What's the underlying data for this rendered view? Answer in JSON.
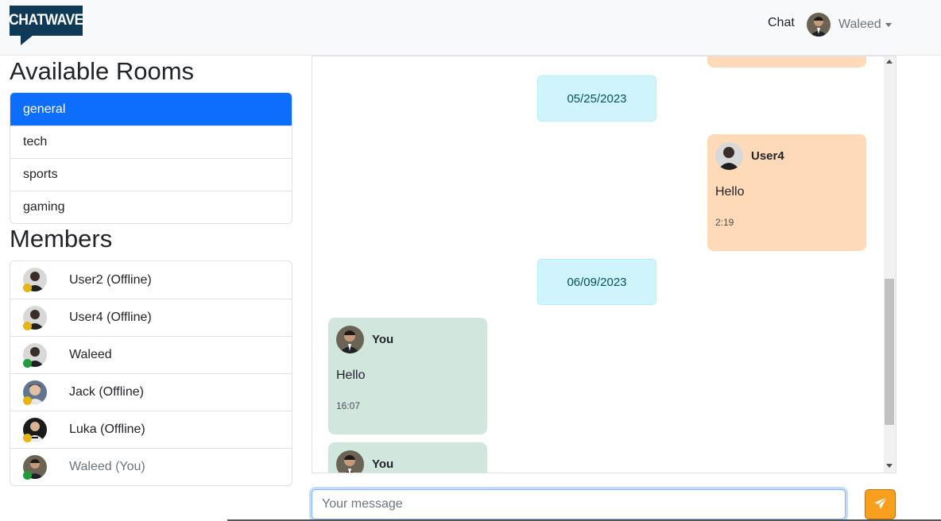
{
  "navbar": {
    "logo_text": "CHATWAVE",
    "chat_link": "Chat",
    "user_name": "Waleed"
  },
  "rooms": {
    "heading": "Available Rooms",
    "items": [
      {
        "label": "general",
        "active": true
      },
      {
        "label": "tech",
        "active": false
      },
      {
        "label": "sports",
        "active": false
      },
      {
        "label": "gaming",
        "active": false
      }
    ]
  },
  "members": {
    "heading": "Members",
    "items": [
      {
        "label": "User2 (Offline)",
        "status": "away"
      },
      {
        "label": "User4 (Offline)",
        "status": "away"
      },
      {
        "label": "Waleed",
        "status": "online"
      },
      {
        "label": "Jack (Offline)",
        "status": "away"
      },
      {
        "label": "Luka (Offline)",
        "status": "away"
      },
      {
        "label": "Waleed (You)",
        "status": "online"
      }
    ]
  },
  "messages": {
    "dates": [
      "05/25/2023",
      "06/09/2023"
    ],
    "items": [
      {
        "sender": "User4",
        "text": "Hello",
        "time": "2:19"
      },
      {
        "sender": "You",
        "text": "Hello",
        "time": "16:07"
      },
      {
        "sender": "You"
      }
    ]
  },
  "composer": {
    "placeholder": "Your message"
  },
  "colors": {
    "primary": "#0d6efd",
    "status_away": "#e7b416",
    "status_online": "#1e9e3a",
    "bubble_other": "#ffdab9",
    "bubble_mine": "#d1e7dd",
    "date_pill": "#cff4fc",
    "send_button": "#f8a01e"
  },
  "icons": {
    "send": "paper-plane-icon",
    "dropdown": "caret-down-icon"
  }
}
